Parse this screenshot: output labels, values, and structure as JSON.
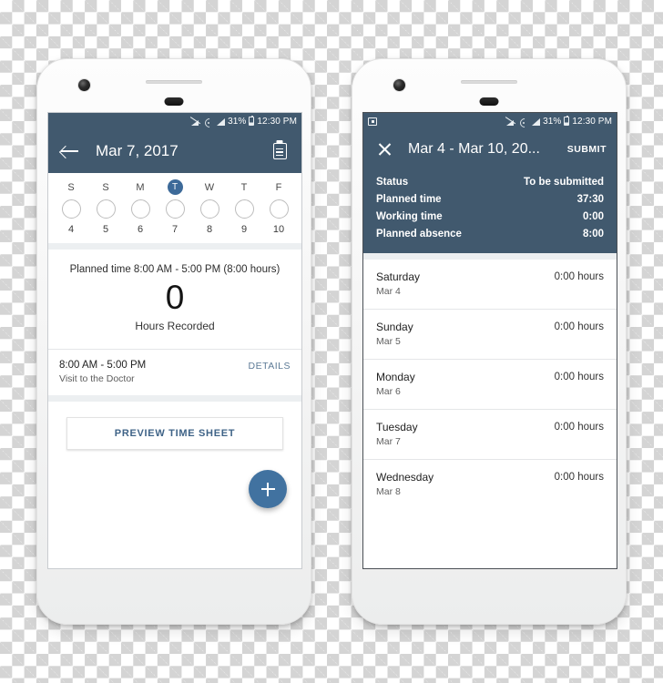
{
  "phones": {
    "left": {
      "status_bar": {
        "icons": [
          "cast-off-icon",
          "wifi-icon",
          "signal-icon",
          "battery-icon"
        ],
        "battery": "31%",
        "time": "12:30 PM"
      },
      "app_bar": {
        "back_icon": "arrow-back-icon",
        "title": "Mar 7, 2017",
        "action_icon": "clipboard-icon"
      },
      "week_strip": [
        {
          "dow": "S",
          "day": "4",
          "selected": false
        },
        {
          "dow": "S",
          "day": "5",
          "selected": false
        },
        {
          "dow": "M",
          "day": "6",
          "selected": false
        },
        {
          "dow": "T",
          "day": "7",
          "selected": true
        },
        {
          "dow": "W",
          "day": "8",
          "selected": false
        },
        {
          "dow": "T",
          "day": "9",
          "selected": false
        },
        {
          "dow": "F",
          "day": "10",
          "selected": false
        }
      ],
      "summary": {
        "planned": "Planned time 8:00 AM - 5:00 PM (8:00 hours)",
        "hours_value": "0",
        "hours_label": "Hours Recorded"
      },
      "entry": {
        "time": "8:00 AM - 5:00 PM",
        "description": "Visit to the Doctor",
        "details_label": "DETAILS"
      },
      "preview_button": "PREVIEW TIME SHEET",
      "fab": {
        "icon": "plus-icon"
      }
    },
    "right": {
      "status_bar": {
        "left_icon": "screenshot-icon",
        "icons": [
          "cast-off-icon",
          "wifi-icon",
          "signal-icon",
          "battery-icon"
        ],
        "battery": "31%",
        "time": "12:30 PM"
      },
      "app_bar": {
        "close_icon": "close-icon",
        "title": "Mar 4 - Mar 10, 20...",
        "submit_label": "SUBMIT"
      },
      "summary_rows": [
        {
          "label": "Status",
          "value": "To be submitted"
        },
        {
          "label": "Planned time",
          "value": "37:30"
        },
        {
          "label": "Working time",
          "value": "0:00"
        },
        {
          "label": "Planned absence",
          "value": "8:00"
        }
      ],
      "days": [
        {
          "name": "Saturday",
          "date": "Mar 4",
          "hours": "0:00 hours"
        },
        {
          "name": "Sunday",
          "date": "Mar 5",
          "hours": "0:00 hours"
        },
        {
          "name": "Monday",
          "date": "Mar 6",
          "hours": "0:00 hours"
        },
        {
          "name": "Tuesday",
          "date": "Mar 7",
          "hours": "0:00 hours"
        },
        {
          "name": "Wednesday",
          "date": "Mar 8",
          "hours": "0:00 hours"
        }
      ]
    }
  },
  "colors": {
    "app_bar": "#41596e",
    "selected_day": "#3d6a99",
    "fab": "#4172a0",
    "link": "#5c7a96"
  }
}
